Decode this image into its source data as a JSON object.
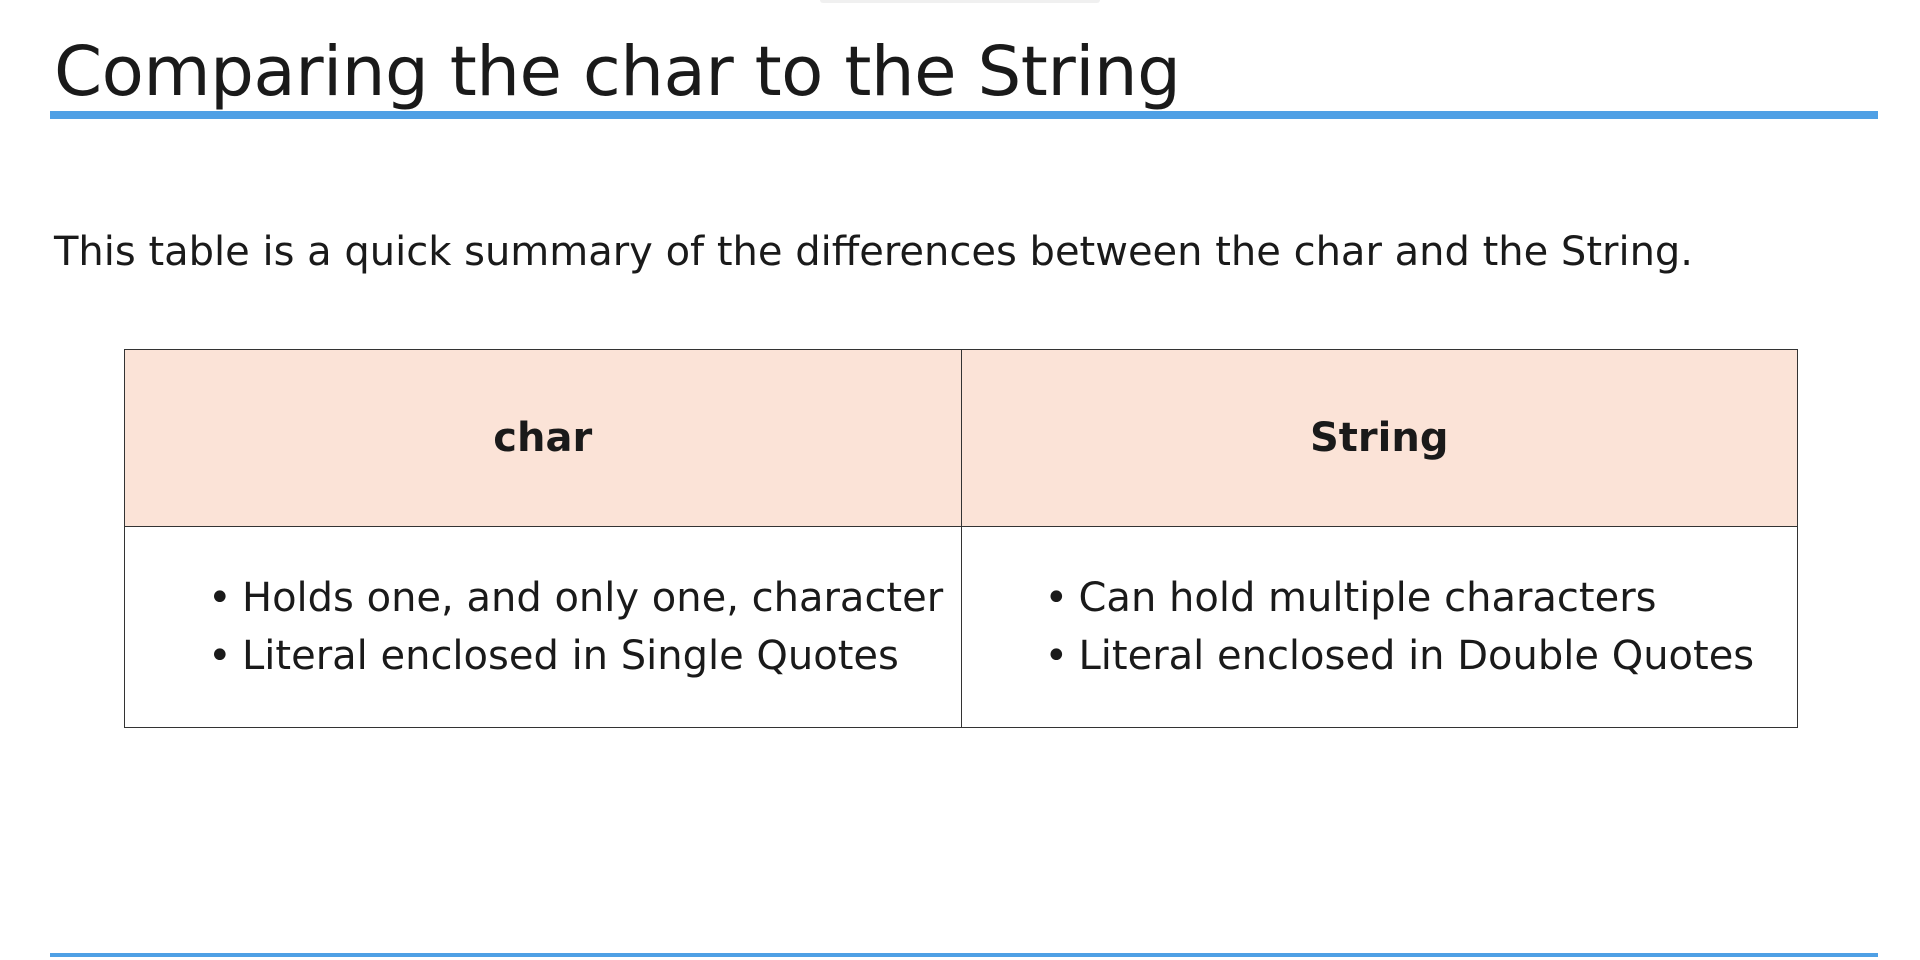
{
  "slide": {
    "title": "Comparing the char to the String",
    "intro": "This table is a quick summary of the differences between the char and the String.",
    "table": {
      "headers": [
        "char",
        "String"
      ],
      "columns": [
        {
          "bullets": [
            "Holds one, and only one, character",
            "Literal enclosed in Single Quotes"
          ]
        },
        {
          "bullets": [
            "Can hold multiple characters",
            "Literal enclosed in Double Quotes"
          ]
        }
      ]
    }
  },
  "colors": {
    "accent_rule": "#4fa0e5",
    "header_fill": "#fbe3d7",
    "text": "#1a1a1a",
    "border": "#333333"
  }
}
